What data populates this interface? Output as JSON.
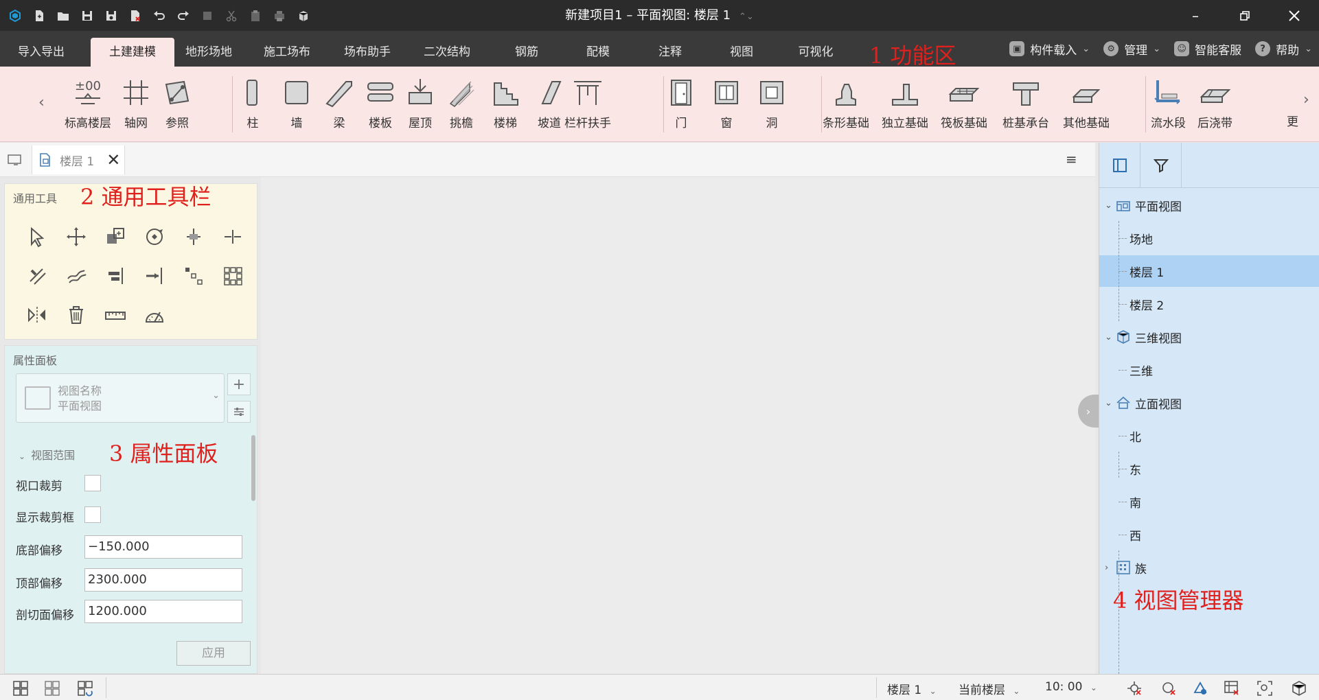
{
  "window": {
    "title": "新建项目1 – 平面视图: 楼层 1",
    "switch_glyph": "⌃⌄",
    "buttons": [
      "minimize",
      "restore",
      "close"
    ]
  },
  "ribbon_tabs": [
    {
      "label": "导入导出",
      "active": false
    },
    {
      "label": "土建建模",
      "active": true
    },
    {
      "label": "地形场地",
      "active": false
    },
    {
      "label": "施工场布",
      "active": false
    },
    {
      "label": "场布助手",
      "active": false
    },
    {
      "label": "二次结构",
      "active": false
    },
    {
      "label": "钢筋",
      "active": false
    },
    {
      "label": "配模",
      "active": false
    },
    {
      "label": "注释",
      "active": false
    },
    {
      "label": "视图",
      "active": false
    },
    {
      "label": "可视化",
      "active": false
    }
  ],
  "right_menus": [
    {
      "label": "构件载入",
      "dropdown": true
    },
    {
      "label": "管理",
      "dropdown": true
    },
    {
      "label": "智能客服",
      "dropdown": false
    },
    {
      "label": "帮助",
      "dropdown": true
    }
  ],
  "annotations": {
    "a1": "1 功能区",
    "a2": "2 通用工具栏",
    "a3": "3 属性面板",
    "a4": "4 视图管理器"
  },
  "ribbon_groups": [
    [
      {
        "label": "标高楼层",
        "icon": "level-icon"
      },
      {
        "label": "轴网",
        "icon": "grid-icon"
      },
      {
        "label": "参照",
        "icon": "reference-icon"
      }
    ],
    [
      {
        "label": "柱",
        "icon": "column-icon"
      },
      {
        "label": "墙",
        "icon": "wall-icon"
      },
      {
        "label": "梁",
        "icon": "beam-icon"
      },
      {
        "label": "楼板",
        "icon": "slab-icon"
      },
      {
        "label": "屋顶",
        "icon": "roof-icon"
      },
      {
        "label": "挑檐",
        "icon": "cornice-icon"
      },
      {
        "label": "楼梯",
        "icon": "stair-icon"
      },
      {
        "label": "坡道",
        "icon": "ramp-icon"
      },
      {
        "label": "栏杆扶手",
        "icon": "railing-icon"
      }
    ],
    [
      {
        "label": "门",
        "icon": "door-icon"
      },
      {
        "label": "窗",
        "icon": "window-icon"
      },
      {
        "label": "洞",
        "icon": "opening-icon"
      }
    ],
    [
      {
        "label": "条形基础",
        "icon": "strip-footing-icon"
      },
      {
        "label": "独立基础",
        "icon": "isolated-footing-icon"
      },
      {
        "label": "筏板基础",
        "icon": "raft-foundation-icon"
      },
      {
        "label": "桩基承台",
        "icon": "pile-cap-icon"
      },
      {
        "label": "其他基础",
        "icon": "other-foundation-icon"
      }
    ],
    [
      {
        "label": "流水段",
        "icon": "flow-segment-icon"
      },
      {
        "label": "后浇带",
        "icon": "post-pour-strip-icon"
      }
    ]
  ],
  "ribbon_more_label": "更",
  "ribbon_level_text": "±00",
  "doc_tab": {
    "label": "楼层 1",
    "close": "✕"
  },
  "menu_glyph": "≡",
  "tools_panel": {
    "title": "通用工具",
    "tools": [
      "select-icon",
      "move-icon",
      "copy-icon",
      "rotate-icon",
      "trim-icon",
      "split-icon",
      "offset-icon",
      "stretch-icon",
      "align-icon",
      "extend-icon",
      "array-linear-icon",
      "array-grid-icon",
      "mirror-icon",
      "delete-icon",
      "measure-icon",
      "protractor-icon"
    ]
  },
  "props_panel": {
    "title": "属性面板",
    "view_name_label": "视图名称",
    "view_name_value": "平面视图",
    "section": "视图范围",
    "rows": {
      "crop": {
        "label": "视口裁剪"
      },
      "show_crop": {
        "label": "显示裁剪框"
      },
      "bottom": {
        "label": "底部偏移",
        "value": "−150.000"
      },
      "top": {
        "label": "顶部偏移",
        "value": "2300.000"
      },
      "cut": {
        "label": "剖切面偏移",
        "value": "1200.000"
      }
    },
    "apply": "应用"
  },
  "view_manager": {
    "tree": [
      {
        "label": "平面视图",
        "level": 0,
        "expanded": true,
        "icon": "plan-view-icon"
      },
      {
        "label": "场地",
        "level": 1
      },
      {
        "label": "楼层 1",
        "level": 1,
        "selected": true
      },
      {
        "label": "楼层 2",
        "level": 1
      },
      {
        "label": "三维视图",
        "level": 0,
        "expanded": true,
        "icon": "3d-view-icon"
      },
      {
        "label": "三维",
        "level": 1
      },
      {
        "label": "立面视图",
        "level": 0,
        "expanded": true,
        "icon": "elevation-view-icon"
      },
      {
        "label": "北",
        "level": 1
      },
      {
        "label": "东",
        "level": 1
      },
      {
        "label": "南",
        "level": 1
      },
      {
        "label": "西",
        "level": 1
      },
      {
        "label": "族",
        "level": 0,
        "expanded": false,
        "icon": "family-icon"
      }
    ]
  },
  "status": {
    "floor": "楼层 1",
    "scope": "当前楼层",
    "time": "10: 00"
  },
  "colors": {
    "accent": "#e0201c",
    "ribbon_bg": "#fbe6e6",
    "tools_bg": "#fcf7e2",
    "props_bg": "#e0f1f1",
    "view_mgr_bg": "#d6e8f8",
    "selected": "#aed2f4",
    "brand": "#1e9ad6"
  }
}
